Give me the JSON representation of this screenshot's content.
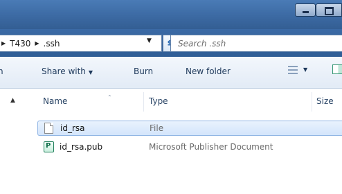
{
  "window": {
    "minimize_icon": "minimize-icon",
    "maximize_icon": "maximize-icon"
  },
  "address_bar": {
    "crumbs": [
      "T430",
      ".ssh"
    ],
    "search_placeholder": "Search .ssh"
  },
  "toolbar": {
    "organize_fragment": "n",
    "share_with_label": "Share with",
    "burn_label": "Burn",
    "new_folder_label": "New folder"
  },
  "columns": {
    "name": "Name",
    "type": "Type",
    "size": "Size"
  },
  "files": [
    {
      "name": "id_rsa",
      "type": "File",
      "icon": "file-icon",
      "selected": true
    },
    {
      "name": "id_rsa.pub",
      "type": "Microsoft Publisher Document",
      "icon": "publisher-icon",
      "selected": false
    }
  ],
  "colors": {
    "titlebar": "#3c6aa3",
    "toolbar_text": "#1e395b",
    "selection": "#d3e5fb"
  }
}
